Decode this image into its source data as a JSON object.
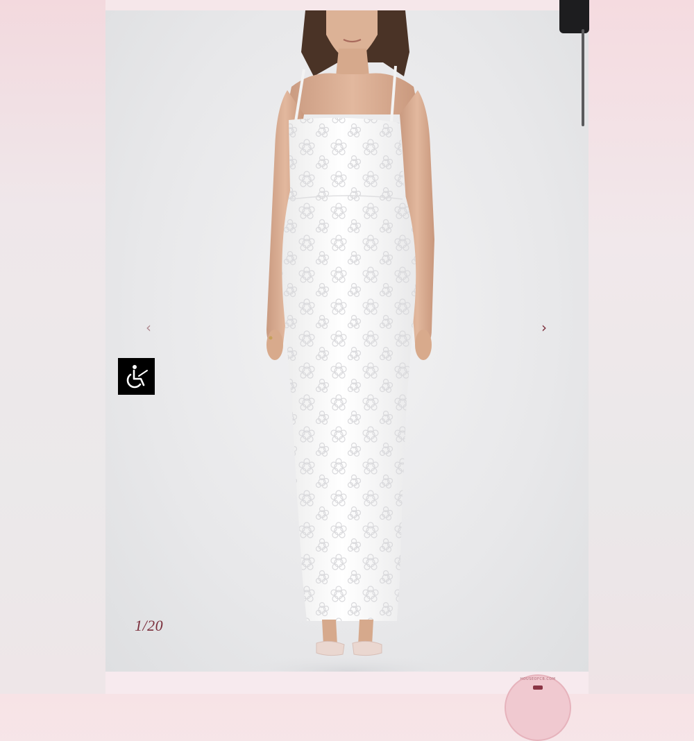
{
  "gallery": {
    "counter": "1/20",
    "prev_icon": "‹",
    "next_icon": "›"
  },
  "accessibility": {
    "icon": "wheelchair-icon"
  },
  "badge": {
    "text": "HOUSEOFCB.COM"
  },
  "colors": {
    "accent": "#7a2d3a",
    "backdrop": "#e8e8ea",
    "page_tint": "#f4e4e7"
  }
}
